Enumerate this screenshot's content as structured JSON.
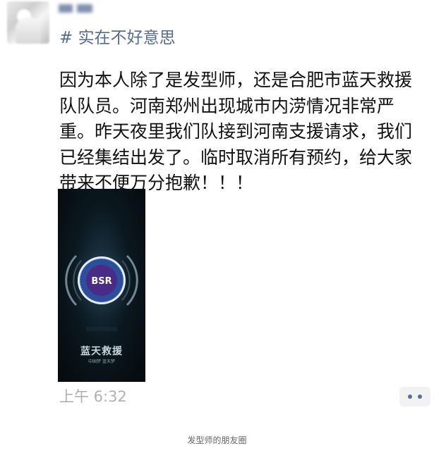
{
  "post": {
    "tag": "# 实在不好意思",
    "text_lines": [
      "因为本人除了是发型师，还是合肥市蓝天救援",
      "队队员。河南郑州出现城市内涝情况非常严",
      "重。昨天夜里我们队接到河南支援请求，我们",
      "已经集结出发了。临时取消所有预约，给大家",
      "带来不便万分抱歉！！！"
    ],
    "image": {
      "logo_text": "BSR",
      "title": "蓝天救援",
      "subtitle": "中国梦 蓝天梦"
    },
    "timestamp": "上午 6:32",
    "more_icon": "more-dots-icon"
  },
  "caption": "发型师的朋友圈",
  "colors": {
    "link_blue": "#576b95",
    "timestamp_gray": "#b1b1b1",
    "logo_blue": "#2b4f9c"
  }
}
